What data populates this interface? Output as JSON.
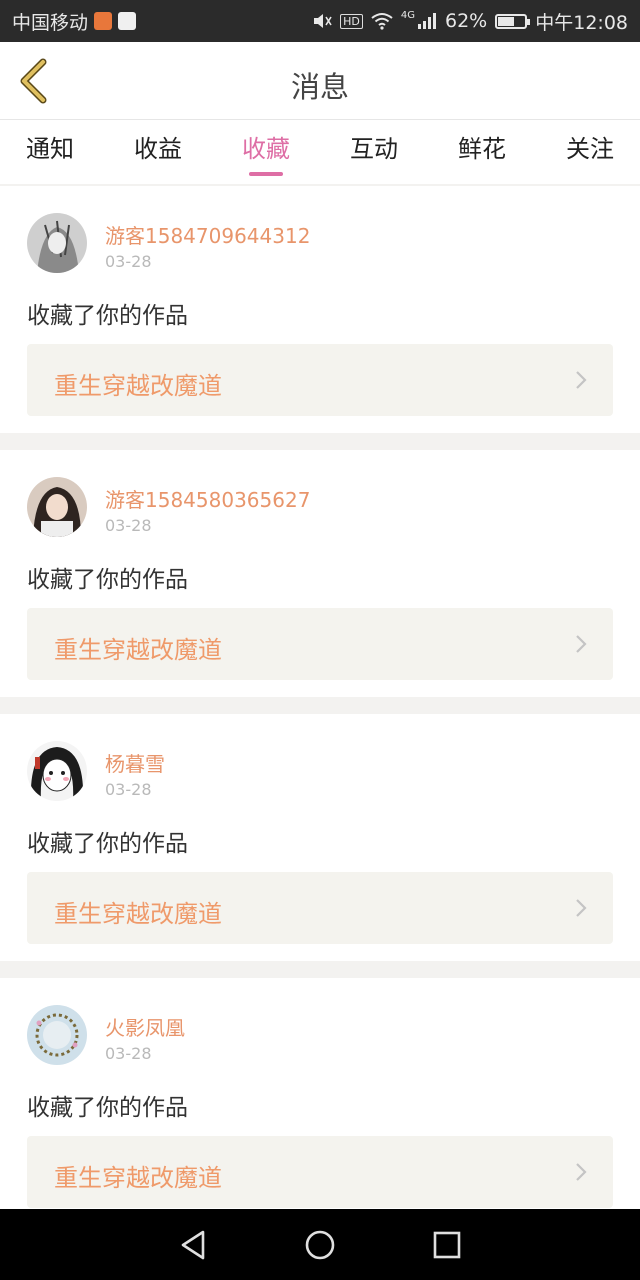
{
  "statusbar": {
    "carrier": "中国移动",
    "hd": "HD",
    "network": "4G",
    "battery": "62%",
    "battery_level": 0.62,
    "time": "中午12:08"
  },
  "navbar": {
    "title": "消息"
  },
  "tabs": [
    {
      "label": "通知"
    },
    {
      "label": "收益"
    },
    {
      "label": "收藏"
    },
    {
      "label": "互动"
    },
    {
      "label": "鲜花"
    },
    {
      "label": "关注"
    }
  ],
  "active_tab": "收藏",
  "messages": [
    {
      "user": "游客1584709644312",
      "date": "03-28",
      "text": "收藏了你的作品",
      "work": "重生穿越改魔道"
    },
    {
      "user": "游客1584580365627",
      "date": "03-28",
      "text": "收藏了你的作品",
      "work": "重生穿越改魔道"
    },
    {
      "user": "杨暮雪",
      "date": "03-28",
      "text": "收藏了你的作品",
      "work": "重生穿越改魔道"
    },
    {
      "user": "火影凤凰",
      "date": "03-28",
      "text": "收藏了你的作品",
      "work": "重生穿越改魔道"
    }
  ],
  "colors": {
    "accent": "#de6ea5",
    "name": "#e8956b",
    "work": "#ef9a6a",
    "back_arrow": "#e0c060"
  }
}
